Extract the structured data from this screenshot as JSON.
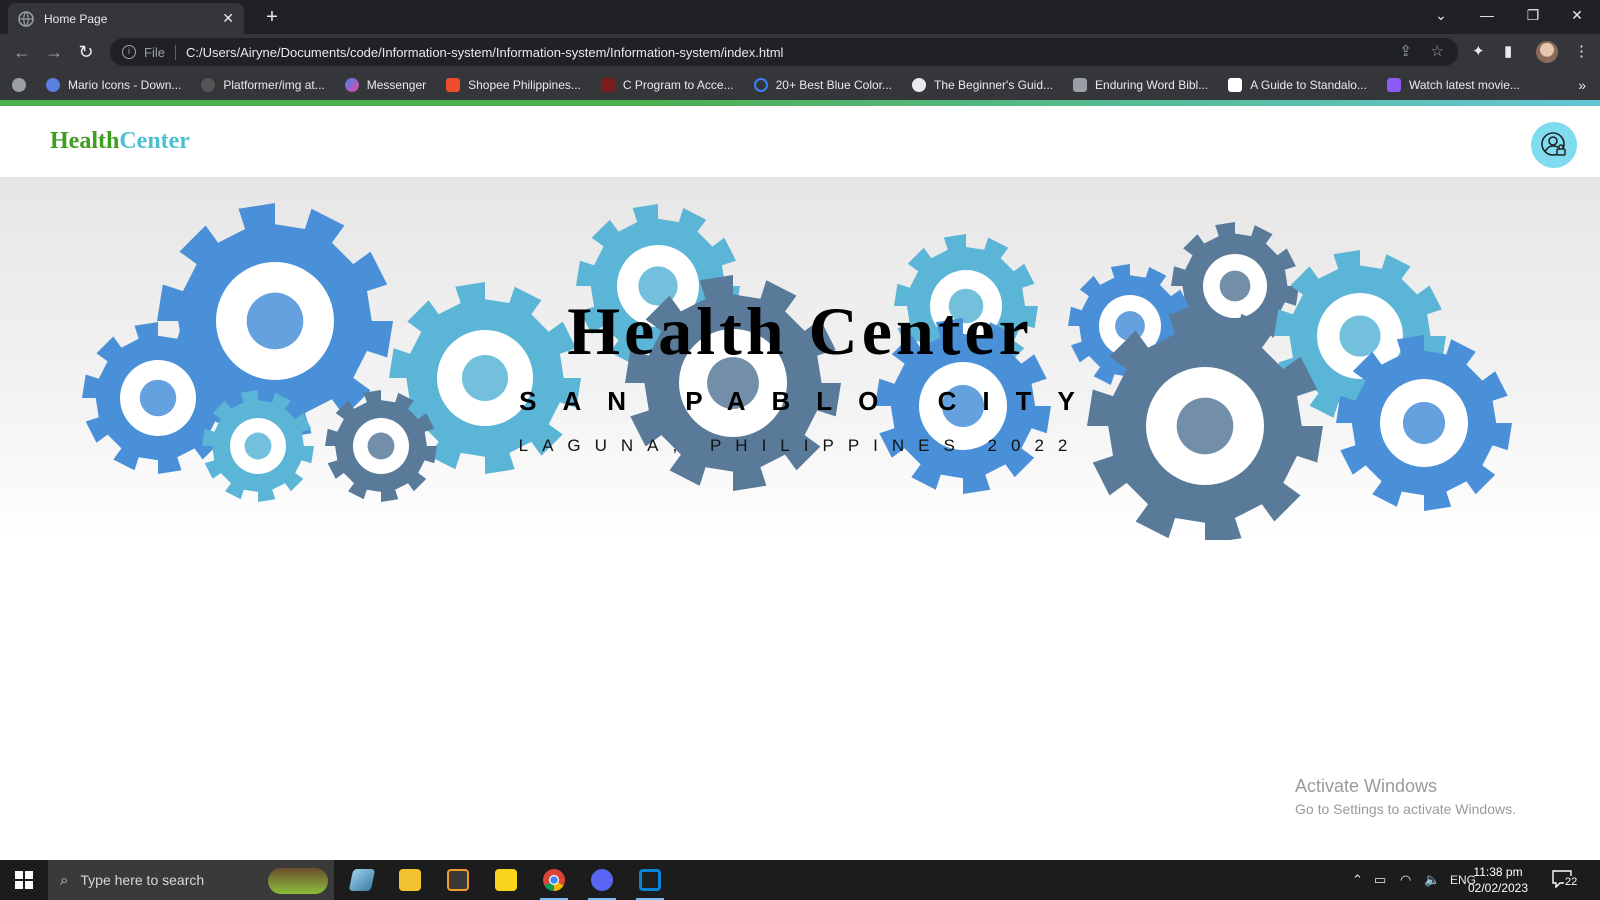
{
  "browser": {
    "tab_title": "Home Page",
    "address_scheme": "File",
    "address_url": "C:/Users/Airyne/Documents/code/Information-system/Information-system/Information-system/index.html",
    "bookmarks": [
      {
        "label": "Mario Icons - Down...",
        "color": "#5b7fe0"
      },
      {
        "label": "Platformer/img at...",
        "color": "#6e6e6e"
      },
      {
        "label": "Messenger",
        "color": "#a45cf0"
      },
      {
        "label": "Shopee Philippines...",
        "color": "#ee4d2d"
      },
      {
        "label": "C Program to Acce...",
        "color": "#c0392b"
      },
      {
        "label": "20+ Best Blue Color...",
        "color": "#3b82f6"
      },
      {
        "label": "The Beginner's Guid...",
        "color": "#e8eaed"
      },
      {
        "label": "Enduring Word Bibl...",
        "color": "#9aa0a6"
      },
      {
        "label": "A Guide to Standalo...",
        "color": "#ffffff"
      },
      {
        "label": "Watch latest movie...",
        "color": "#8b5cf6"
      }
    ]
  },
  "site": {
    "brand_part1": "Health",
    "brand_part2": "Center",
    "brand_colors": {
      "part1": "#3f9d20",
      "part2": "#4cc0d0"
    },
    "user_button_icon": "user-lock-icon"
  },
  "hero": {
    "title": "Health Center",
    "subtitle": "SAN PABLO CITY",
    "tagline": "LAGUNA, PHILIPPINES 2022",
    "gear_colors": [
      "#4a90d9",
      "#5bb5d6",
      "#5a7a9a"
    ]
  },
  "watermark": {
    "line1": "Activate Windows",
    "line2": "Go to Settings to activate Windows."
  },
  "taskbar": {
    "search_placeholder": "Type here to search",
    "language": "ENG",
    "time": "11:38 pm",
    "date": "02/02/2023",
    "notification_count": "22"
  }
}
